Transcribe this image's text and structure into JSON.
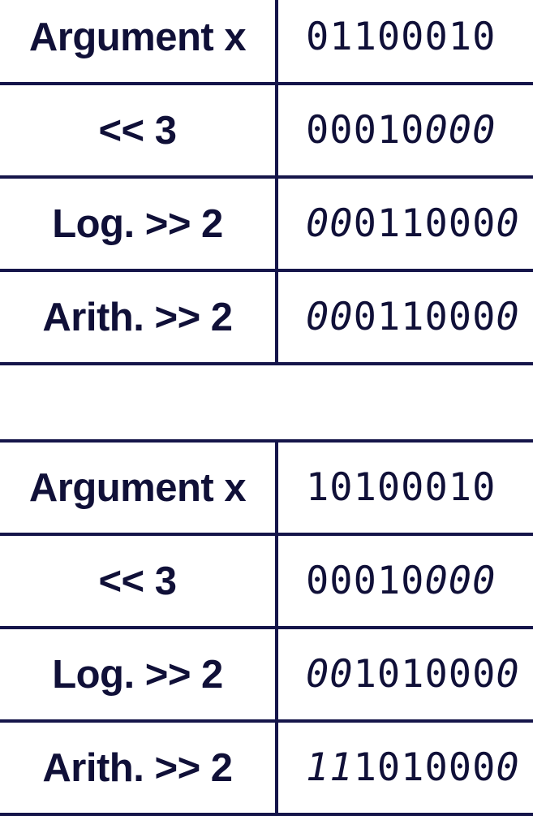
{
  "tables": [
    {
      "rows": [
        {
          "operation": "Argument x",
          "bits_prefix": "",
          "bits": "01100010",
          "bits_suffix": ""
        },
        {
          "operation": "<<  3",
          "bits_prefix": "",
          "bits": "00010",
          "bits_suffix": "000"
        },
        {
          "operation": "Log. >>  2",
          "bits_prefix": "00",
          "bits": "011000",
          "bits_suffix": "0"
        },
        {
          "operation": "Arith. >>  2",
          "bits_prefix": "00",
          "bits": "011000",
          "bits_suffix": "0"
        }
      ]
    },
    {
      "rows": [
        {
          "operation": "Argument x",
          "bits_prefix": "",
          "bits": "10100010",
          "bits_suffix": ""
        },
        {
          "operation": "<<  3",
          "bits_prefix": "",
          "bits": "00010",
          "bits_suffix": "000"
        },
        {
          "operation": "Log. >>  2",
          "bits_prefix": "00",
          "bits": "101000",
          "bits_suffix": "0"
        },
        {
          "operation": "Arith. >>  2",
          "bits_prefix": "11",
          "bits": "101000",
          "bits_suffix": "0"
        }
      ]
    }
  ],
  "colors": {
    "line": "#15154a",
    "text": "#101038",
    "background": "#ffffff"
  }
}
